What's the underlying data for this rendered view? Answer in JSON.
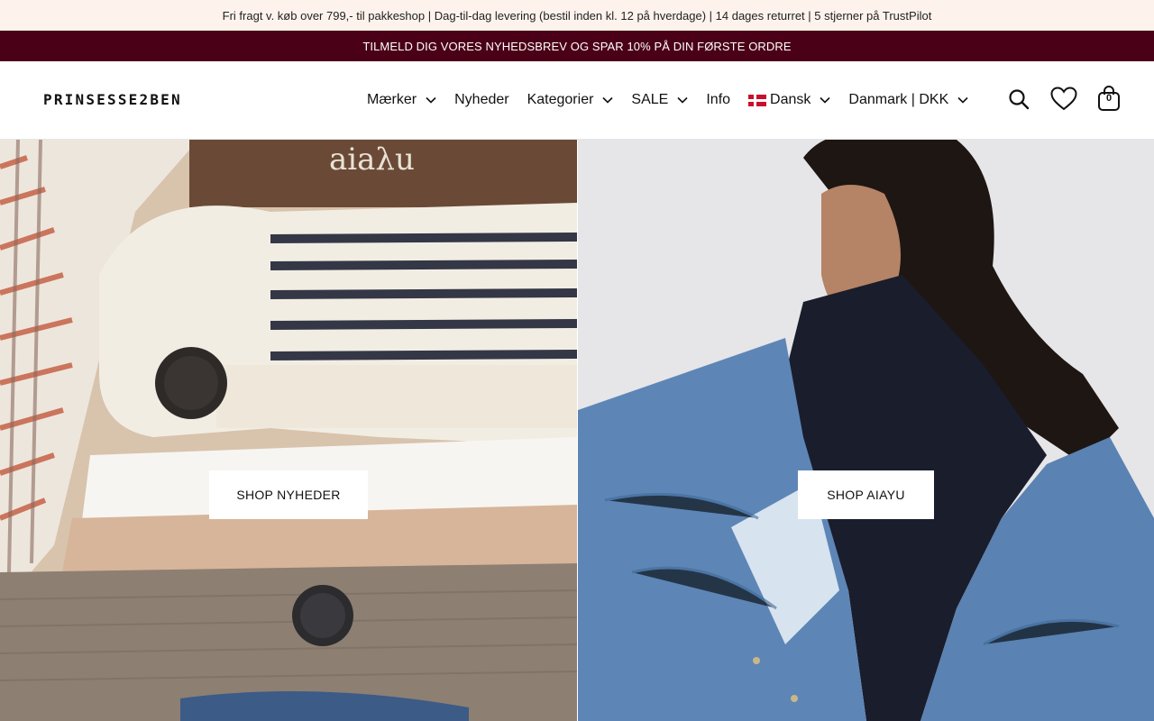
{
  "announcement": {
    "text": "Fri fragt v. køb over 799,- til pakkeshop | Dag-til-dag levering (bestil inden kl. 12 på hverdage) | 14 dages returret | 5 stjerner på TrustPilot"
  },
  "newsletter_bar": {
    "text": "TILMELD DIG VORES NYHEDSBREV OG SPAR 10% PÅ DIN FØRSTE ORDRE"
  },
  "header": {
    "logo": "PRINSESSE2BEN",
    "nav": [
      {
        "label": "Mærker",
        "has_dropdown": true
      },
      {
        "label": "Nyheder",
        "has_dropdown": false
      },
      {
        "label": "Kategorier",
        "has_dropdown": true
      },
      {
        "label": "SALE",
        "has_dropdown": true
      },
      {
        "label": "Info",
        "has_dropdown": false
      },
      {
        "label": "Dansk",
        "has_dropdown": true,
        "icon": "danish-flag-icon"
      },
      {
        "label": "Danmark | DKK",
        "has_dropdown": true
      }
    ],
    "cart_count": "0"
  },
  "hero": {
    "left_cta": "SHOP NYHEDER",
    "right_cta": "SHOP AIAYU",
    "left_image_text": "aiaλu"
  },
  "colors": {
    "announcement_bg": "#fdf3ec",
    "newsletter_bg": "#4a0016",
    "cta_bg": "#ffffff"
  }
}
